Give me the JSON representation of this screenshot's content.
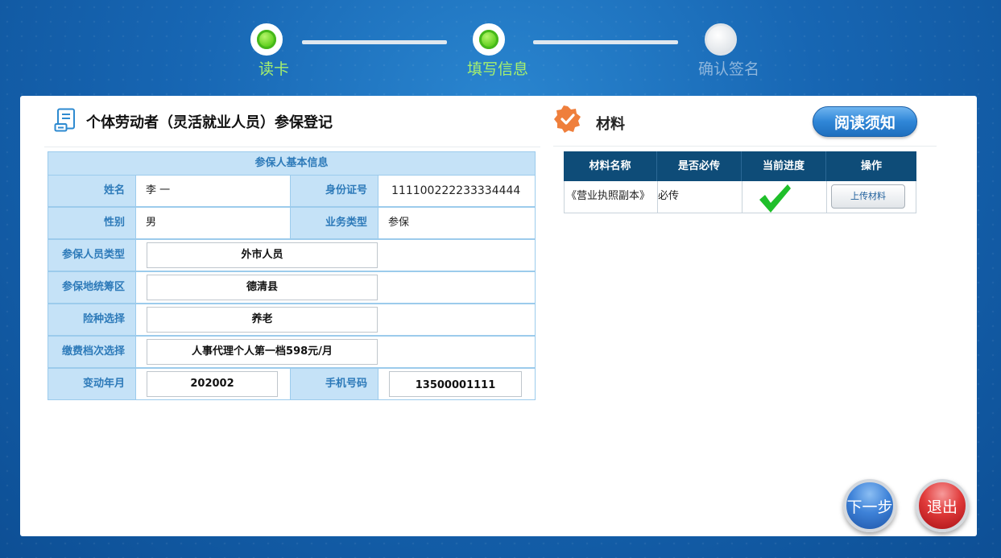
{
  "steps": [
    {
      "label": "读卡",
      "status": "done"
    },
    {
      "label": "填写信息",
      "status": "done"
    },
    {
      "label": "确认签名",
      "status": "pending"
    }
  ],
  "form": {
    "title": "个体劳动者（灵活就业人员）参保登记",
    "section_header": "参保人基本信息",
    "name_label": "姓名",
    "name_value": "李 一",
    "id_label": "身份证号",
    "id_value": "111100222233334444",
    "gender_label": "性别",
    "gender_value": "男",
    "business_label": "业务类型",
    "business_value": "参保",
    "person_type_label": "参保人员类型",
    "person_type_value": "外市人员",
    "region_label": "参保地统筹区",
    "region_value": "德清县",
    "insurance_label": "险种选择",
    "insurance_value": "养老",
    "level_label": "缴费档次选择",
    "level_value": "人事代理个人第一档598元/月",
    "change_date_label": "变动年月",
    "change_date_value": "202002",
    "phone_label": "手机号码",
    "phone_value": "13500001111"
  },
  "materials": {
    "title": "材料",
    "read_button": "阅读须知",
    "columns": [
      "材料名称",
      "是否必传",
      "当前进度",
      "操作"
    ],
    "rows": [
      {
        "name": "《营业执照副本》",
        "required": "必传",
        "progress_icon": "check-icon",
        "action": "上传材料"
      }
    ]
  },
  "buttons": {
    "next": "下一步",
    "exit": "退出"
  },
  "colors": {
    "accent_green": "#5fcf1d",
    "header_blue": "#c5e2f7",
    "table_head_dark": "#0e4c78",
    "next_blue": "#3e82d8",
    "exit_red": "#e03a3a"
  }
}
